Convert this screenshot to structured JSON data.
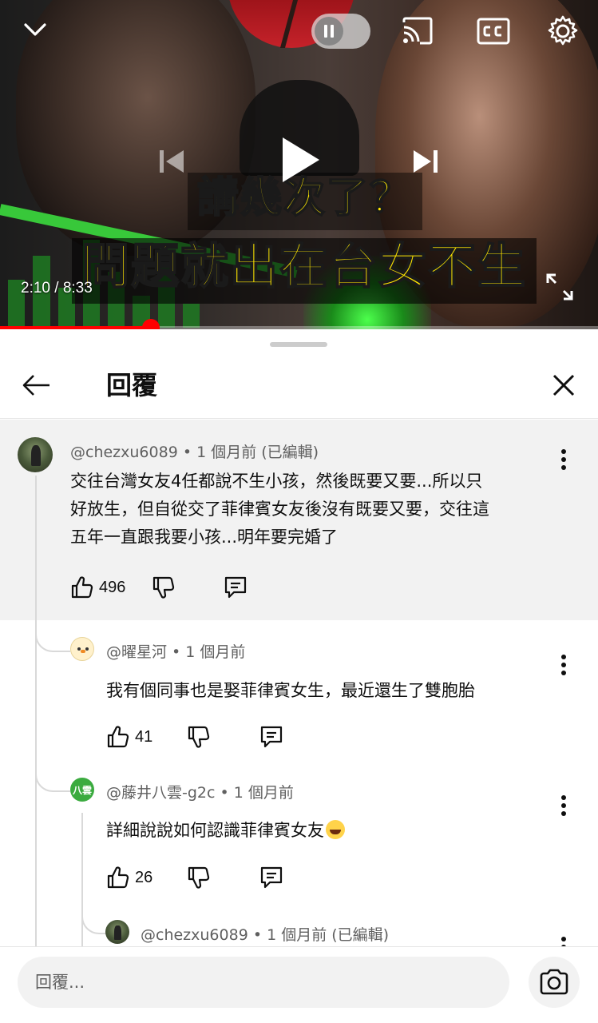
{
  "player": {
    "overlay_line_1": "講幾次了？",
    "overlay_line_2": "問題就出在台女不生",
    "time_current": "2:10",
    "time_separator": " / ",
    "time_total": "8:33",
    "progress_fraction": 0.253,
    "icons": [
      "chevron-down-icon",
      "pause-icon",
      "cast-icon",
      "captions-icon",
      "settings-gear-icon",
      "previous-icon",
      "play-icon",
      "next-icon",
      "fullscreen-icon"
    ]
  },
  "sheet": {
    "title": "回覆"
  },
  "comments": [
    {
      "author": "@chezxu6089",
      "meta": " • 1 個月前 (已編輯)",
      "text_lines": [
        "交往台灣女友4任都說不生小孩，然後既要又要...所以只",
        "好放生，但自從交了菲律賓女友後沒有既要又要，交往這",
        "五年一直跟我要小孩...明年要完婚了"
      ],
      "likes": "496"
    },
    {
      "author": "@曜星河",
      "meta": " • 1 個月前",
      "text": "我有個同事也是娶菲律賓女生，最近還生了雙胞胎",
      "likes": "41"
    },
    {
      "author": "@藤井八雲-g2c",
      "avatar_text": "八雲",
      "meta": " • 1 個月前",
      "text": "詳細說說如何認識菲律賓女友",
      "likes": "26"
    },
    {
      "author": "@chezxu6089",
      "meta": " • 1 個月前 (已編輯)"
    }
  ],
  "reply_bar": {
    "placeholder": "回覆..."
  },
  "colors": {
    "accent_red": "#ff0000",
    "overlay_yellow": "#ffe600",
    "sheet_highlight": "#f2f2f2"
  }
}
